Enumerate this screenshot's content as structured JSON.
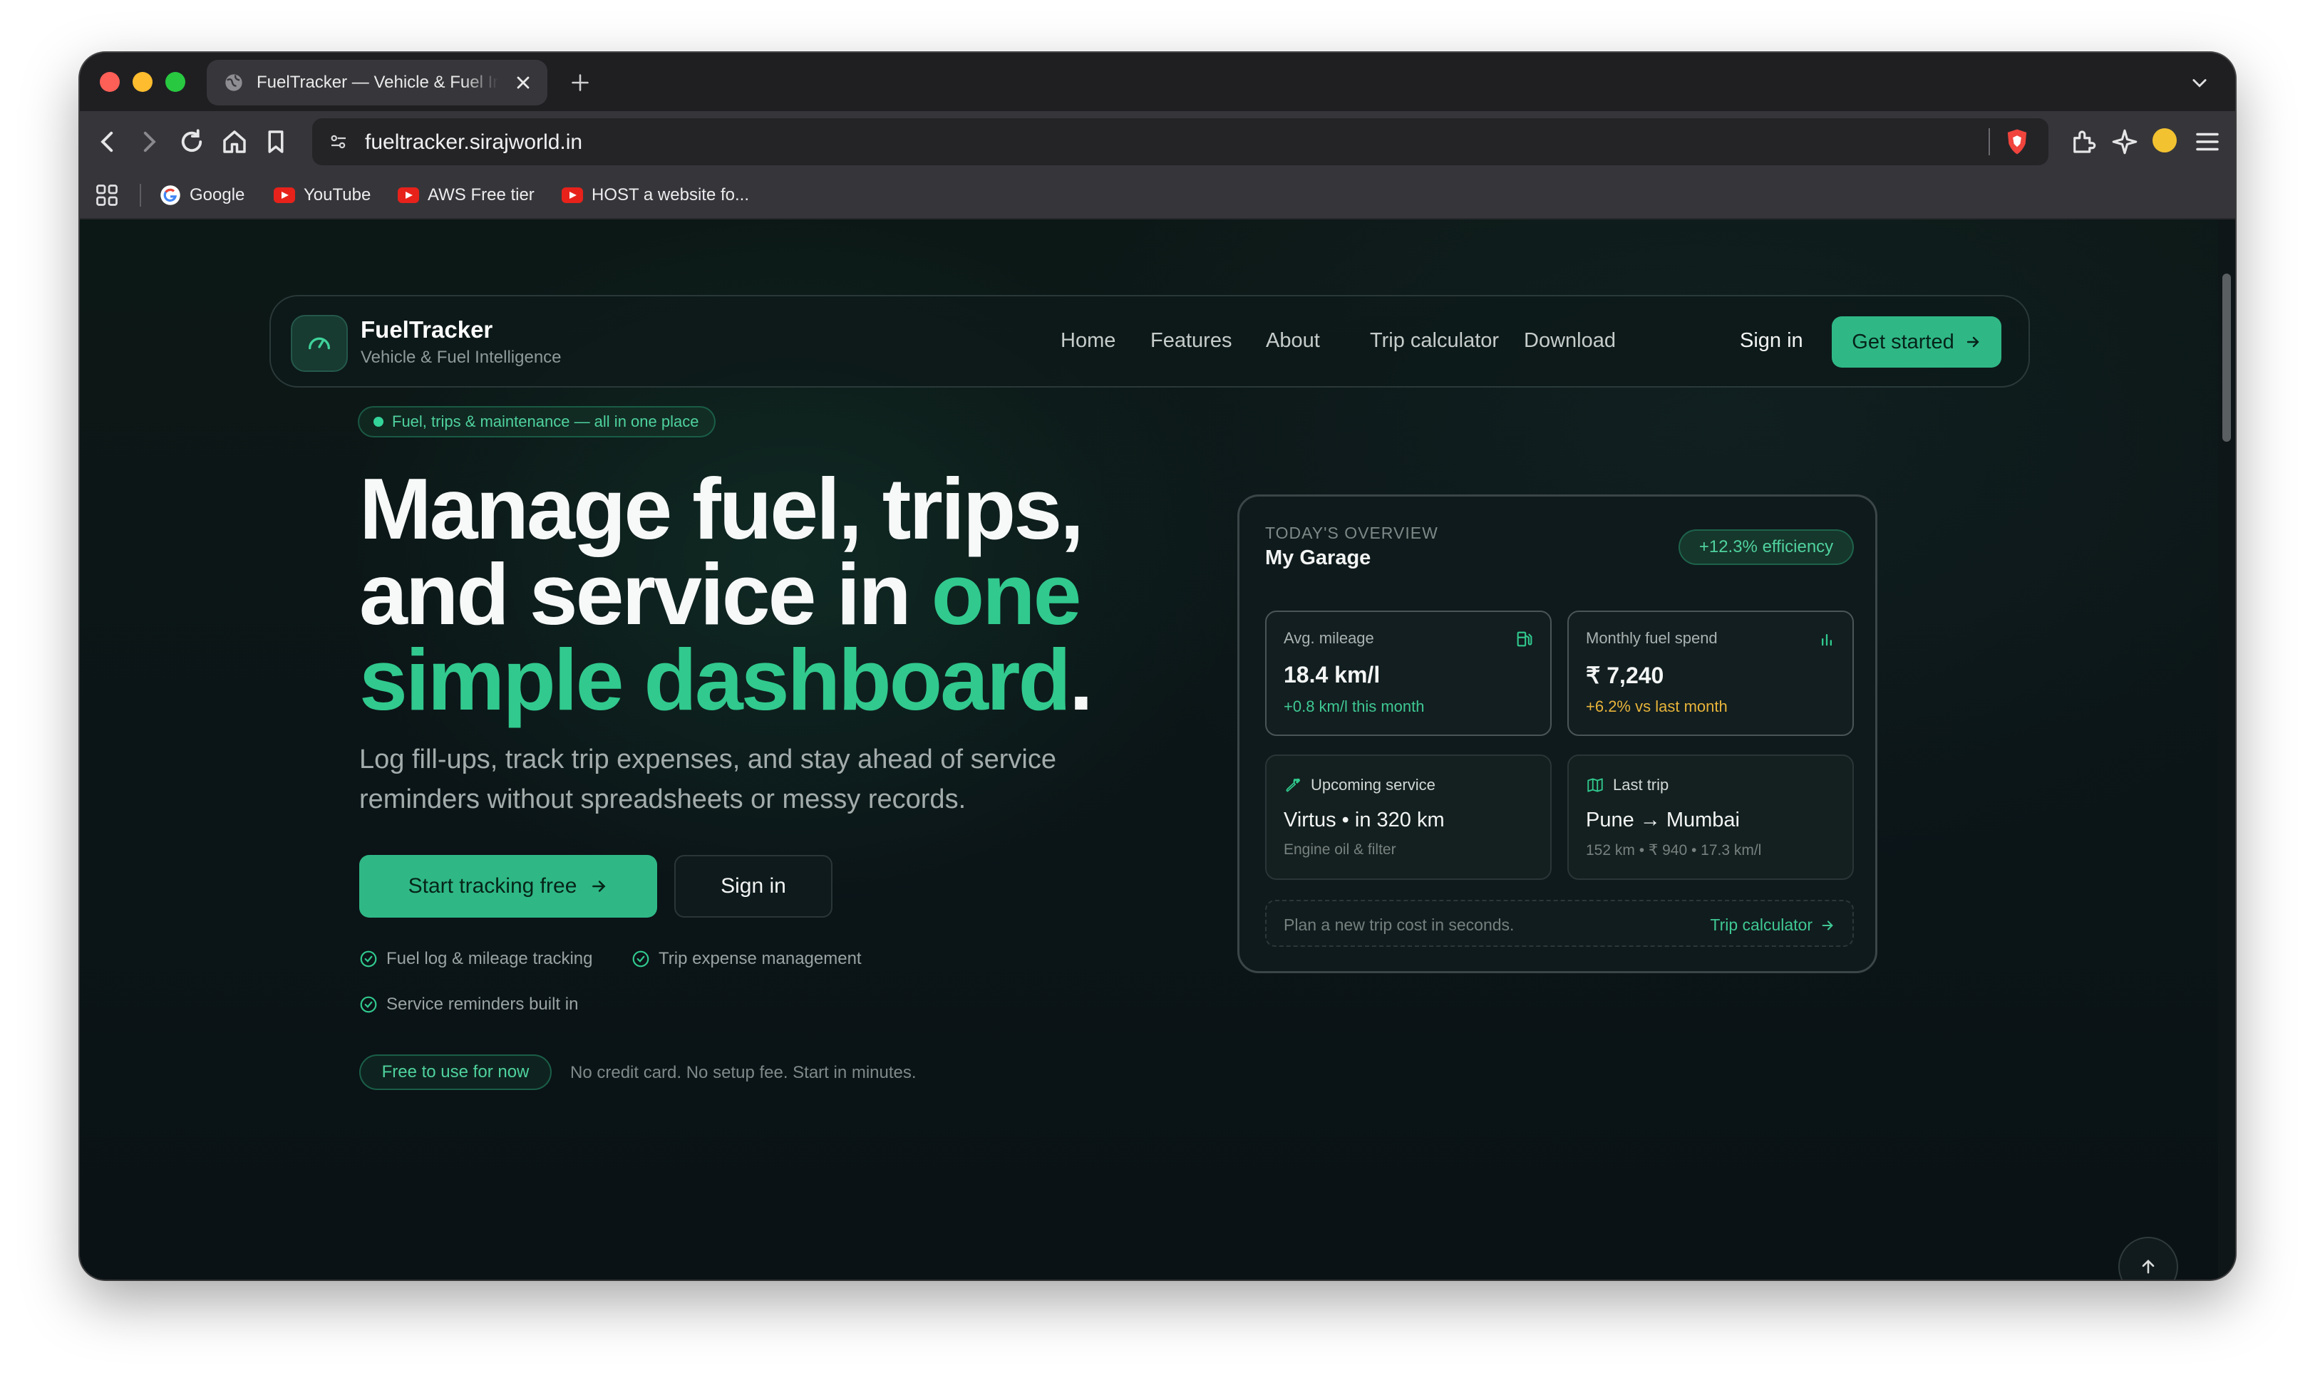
{
  "browser": {
    "tab_title": "FuelTracker — Vehicle & Fuel Intelligence",
    "url": "fueltracker.sirajworld.in",
    "bookmarks": [
      {
        "label": "Google",
        "icon": "google-icon"
      },
      {
        "label": "YouTube",
        "icon": "youtube-icon"
      },
      {
        "label": "AWS Free tier",
        "icon": "youtube-icon"
      },
      {
        "label": "HOST a website fo...",
        "icon": "youtube-icon"
      }
    ]
  },
  "navbar": {
    "brand": "FuelTracker",
    "tagline": "Vehicle & Fuel Intelligence",
    "links": [
      "Home",
      "Features",
      "About",
      "Trip calculator",
      "Download"
    ],
    "sign_in": "Sign in",
    "get_started": "Get started"
  },
  "hero": {
    "pill": "Fuel, trips & maintenance — all in one place",
    "headline_1": "Manage fuel, trips,",
    "headline_2": "and service in ",
    "headline_accent_1": "one",
    "headline_accent_2": "simple dashboard",
    "headline_end": ".",
    "subcopy": "Log fill-ups, track trip expenses, and stay ahead of service reminders without spreadsheets or messy records.",
    "primary_cta": "Start tracking free",
    "secondary_cta": "Sign in",
    "features": [
      "Fuel log & mileage tracking",
      "Trip expense management",
      "Service reminders built in"
    ],
    "free_badge": "Free to use for now",
    "free_note": "No credit card. No setup fee. Start in minutes."
  },
  "dashboard": {
    "overline": "TODAY'S OVERVIEW",
    "title": "My Garage",
    "efficiency_badge": "+12.3% efficiency",
    "mileage": {
      "label": "Avg. mileage",
      "value": "18.4 km/l",
      "delta": "+0.8 km/l this month"
    },
    "fuel_spend": {
      "label": "Monthly fuel spend",
      "value": "₹ 7,240",
      "delta": "+6.2% vs last month"
    },
    "service": {
      "label": "Upcoming service",
      "value": "Virtus • in 320 km",
      "detail": "Engine oil & filter"
    },
    "trip": {
      "label": "Last trip",
      "value": "Pune → Mumbai",
      "detail": "152 km • ₹ 940 • 17.3 km/l"
    },
    "trip_prompt": "Plan a new trip cost in seconds.",
    "trip_link": "Trip calculator"
  },
  "colors": {
    "accent": "#2fb886",
    "accent_text": "#31c98e",
    "warning": "#e8b43a",
    "background": "#0b1417"
  }
}
